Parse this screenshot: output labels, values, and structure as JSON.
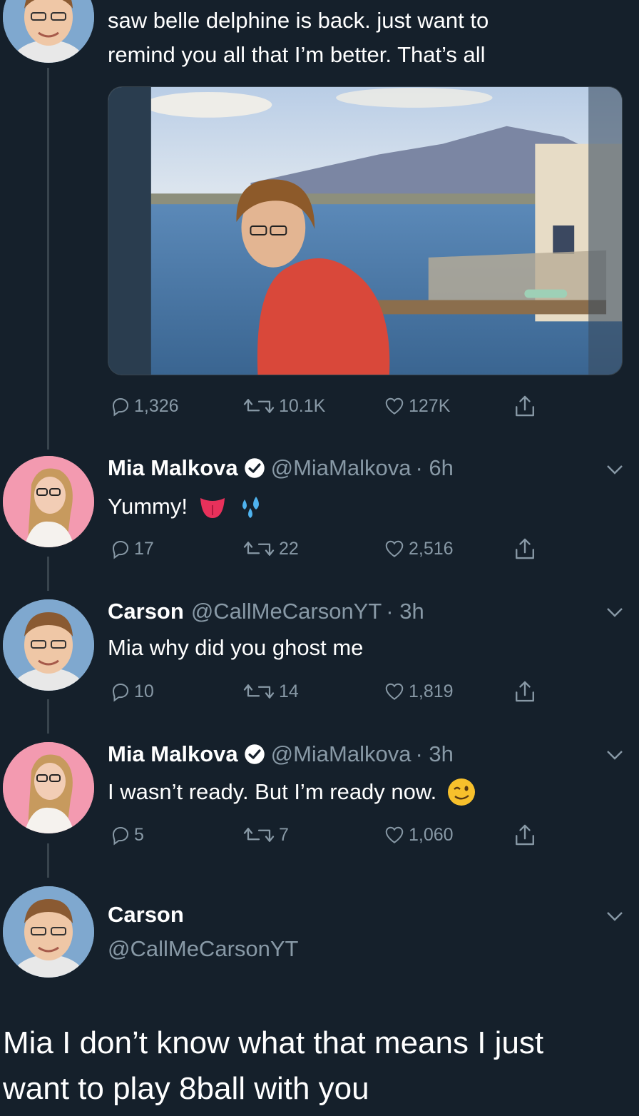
{
  "colors": {
    "background": "#15202b",
    "text_primary": "#ffffff",
    "text_secondary": "#8899a6",
    "divider": "#38444d",
    "verified_badge": "#ffffff"
  },
  "tweet_main": {
    "text_line1": "saw belle delphine is back. just want to",
    "text_line2": "remind you all that I’m better. That’s all",
    "media_icon": "photo",
    "replies": "1,326",
    "retweets": "10.1K",
    "likes": "127K"
  },
  "reply1": {
    "name": "Mia Malkova",
    "handle": "@MiaMalkova",
    "time": "· 6h",
    "text": "Yummy!",
    "emojis": [
      "tongue-emoji",
      "sweat-droplets-emoji"
    ],
    "replies": "17",
    "retweets": "22",
    "likes": "2,516"
  },
  "reply2": {
    "name": "Carson",
    "handle": "@CallMeCarsonYT",
    "time": "· 3h",
    "text": "Mia why did you ghost me",
    "replies": "10",
    "retweets": "14",
    "likes": "1,819"
  },
  "reply3": {
    "name": "Mia Malkova",
    "handle": "@MiaMalkova",
    "time": "· 3h",
    "text": "I wasn’t ready. But I’m ready now.",
    "emojis": [
      "winking-face-emoji"
    ],
    "replies": "5",
    "retweets": "7",
    "likes": "1,060"
  },
  "reply4": {
    "name": "Carson",
    "handle": "@CallMeCarsonYT",
    "text_line1": "Mia I don’t know what that means I just",
    "text_line2": "want to play 8ball with you"
  }
}
